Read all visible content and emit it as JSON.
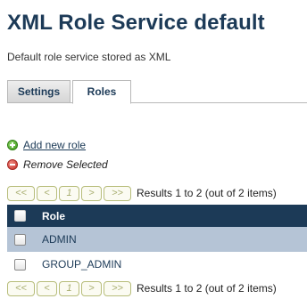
{
  "page": {
    "title": "XML Role Service default",
    "subtitle": "Default role service stored as XML"
  },
  "tabs": [
    {
      "label": "Settings",
      "active": false
    },
    {
      "label": "Roles",
      "active": true
    }
  ],
  "actions": {
    "add_label": "Add new role",
    "remove_label": "Remove Selected"
  },
  "pager": {
    "first": "<<",
    "prev": "<",
    "page": "1",
    "next": ">",
    "last": ">>",
    "results": "Results 1 to 2 (out of 2 items)"
  },
  "table": {
    "header": "Role",
    "rows": [
      {
        "name": "ADMIN"
      },
      {
        "name": "GROUP_ADMIN"
      }
    ]
  },
  "colors": {
    "header_bg": "#1c3a57",
    "row_highlight": "#b5c4d6",
    "title": "#1c3a57"
  }
}
